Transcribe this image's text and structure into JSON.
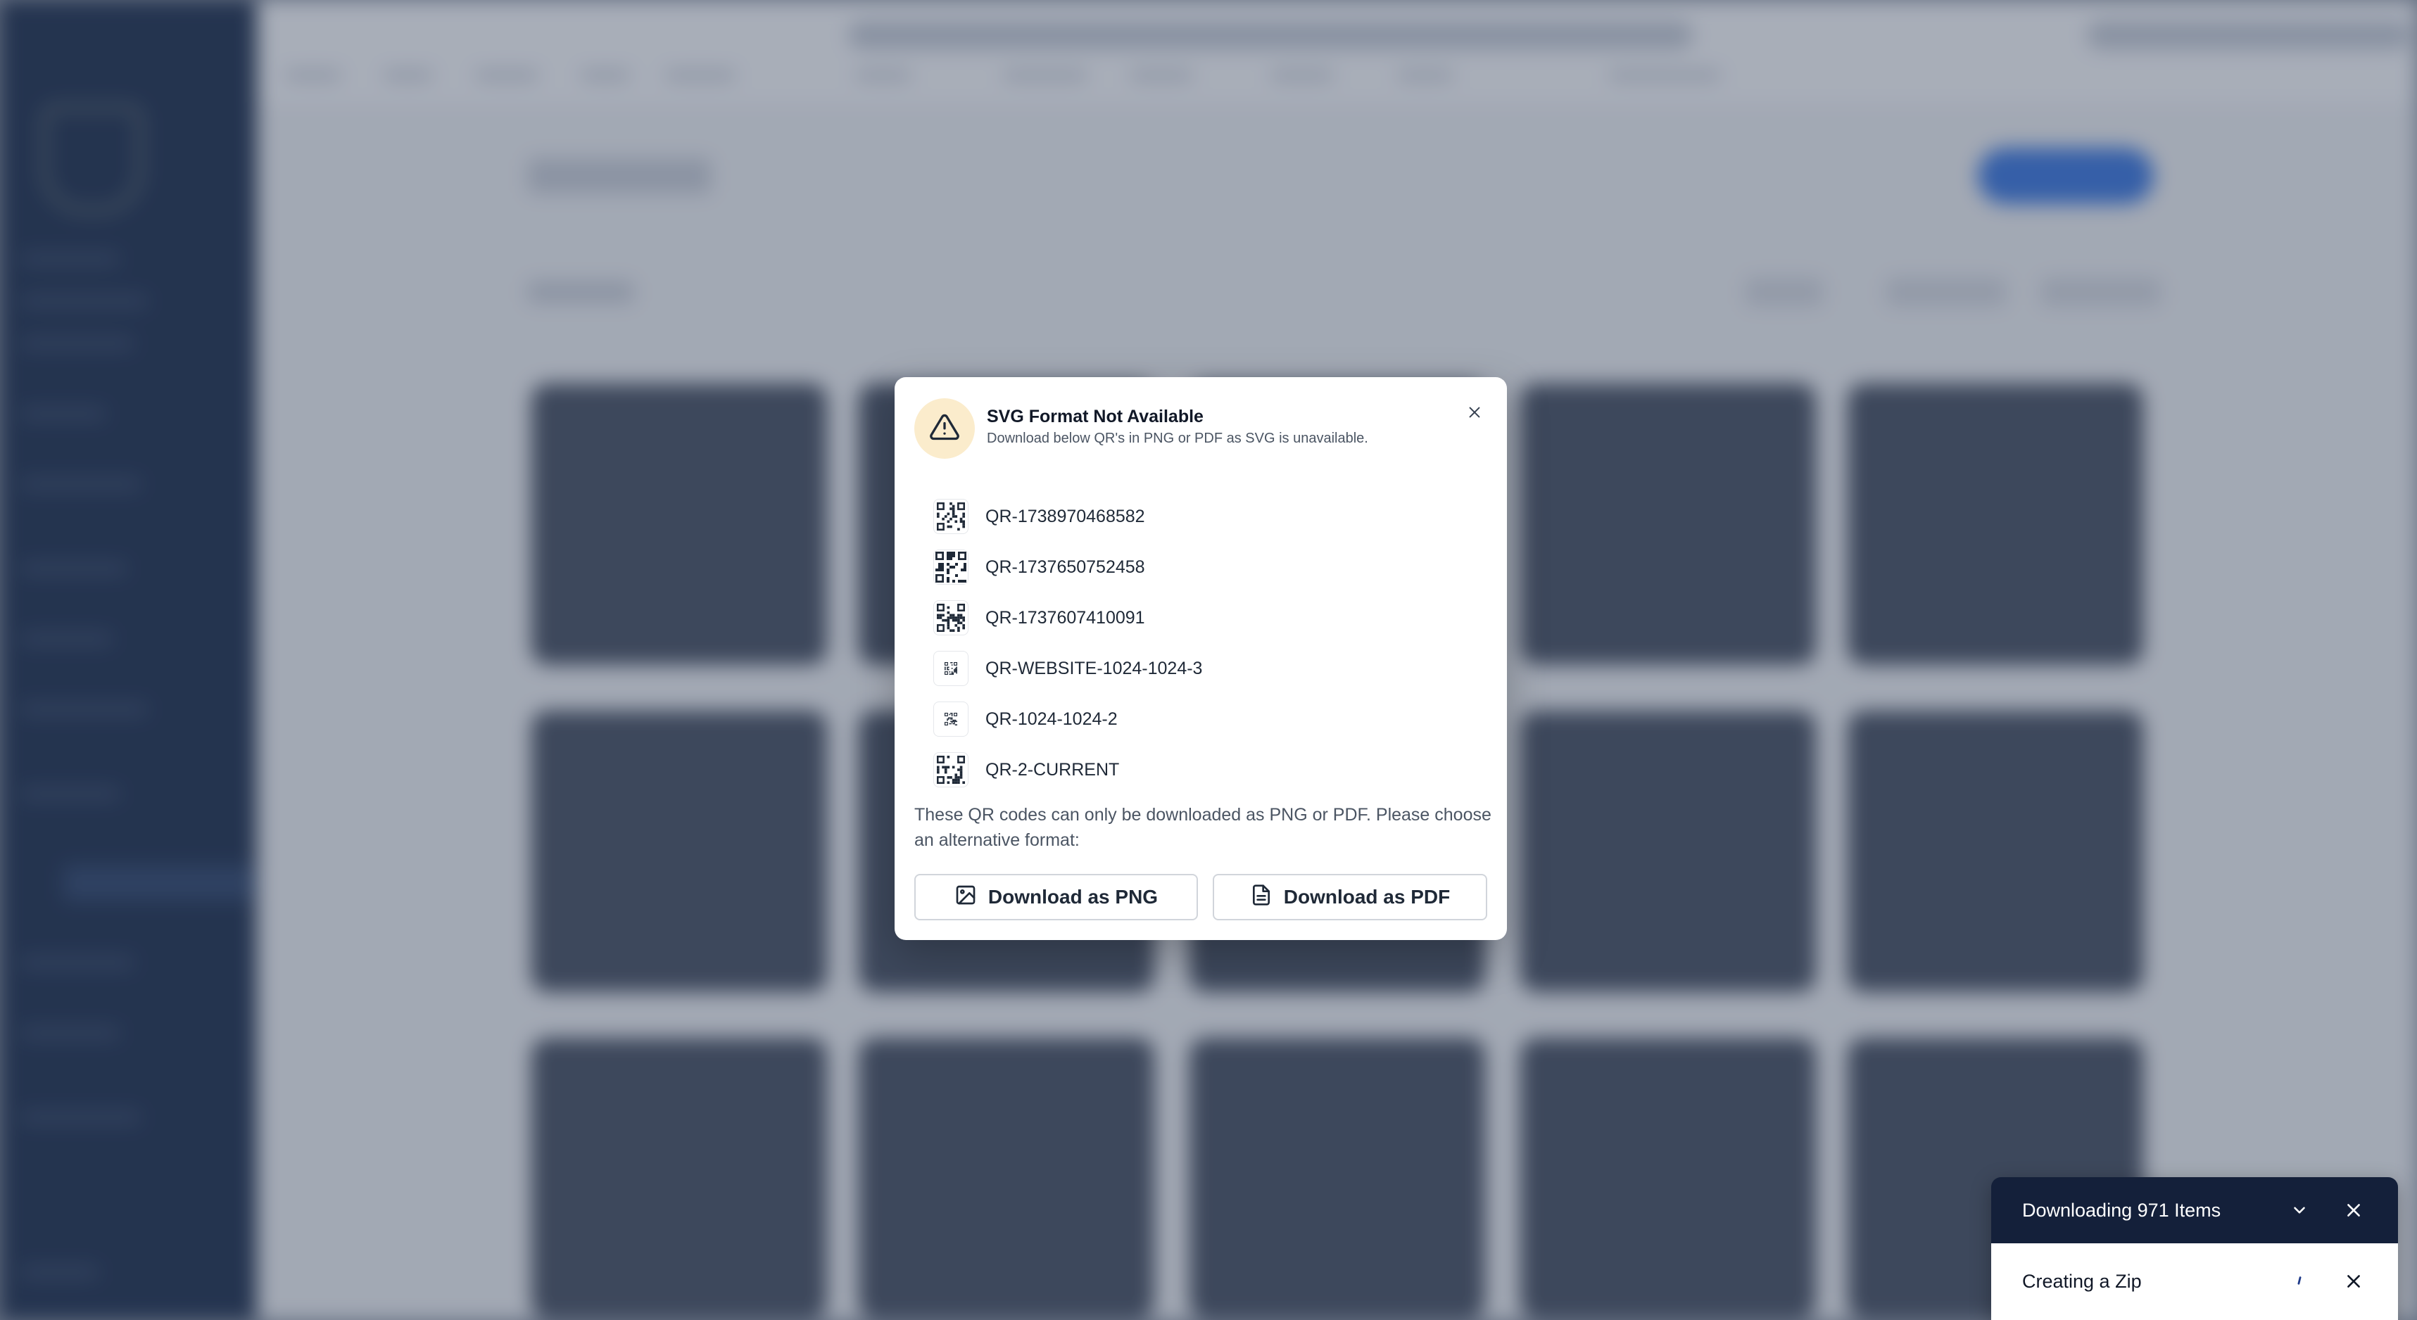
{
  "modal": {
    "title": "SVG Format Not Available",
    "description": "Download below QR's in PNG or PDF as SVG is unavailable.",
    "items": [
      {
        "name": "QR-1738970468582"
      },
      {
        "name": "QR-1737650752458"
      },
      {
        "name": "QR-1737607410091"
      },
      {
        "name": "QR-WEBSITE-1024-1024-3"
      },
      {
        "name": "QR-1024-1024-2"
      },
      {
        "name": "QR-2-CURRENT"
      }
    ],
    "note": "These QR codes can only be downloaded as PNG or PDF. Please choose an alternative format:",
    "png_button": "Download as PNG",
    "pdf_button": "Download as PDF",
    "icons": {
      "warning": "warning-triangle-icon",
      "close": "close-icon",
      "png": "image-icon",
      "pdf": "file-text-icon"
    }
  },
  "toast": {
    "title": "Downloading 971 Items",
    "status": "Creating a Zip",
    "icons": {
      "collapse": "chevron-down-icon",
      "close": "close-icon",
      "spinner": "spinner-icon"
    }
  },
  "colors": {
    "overlay": "#28344c",
    "warning_bg": "#fbeccc",
    "toast_header": "#14203a",
    "primary": "#3f7ae0"
  }
}
